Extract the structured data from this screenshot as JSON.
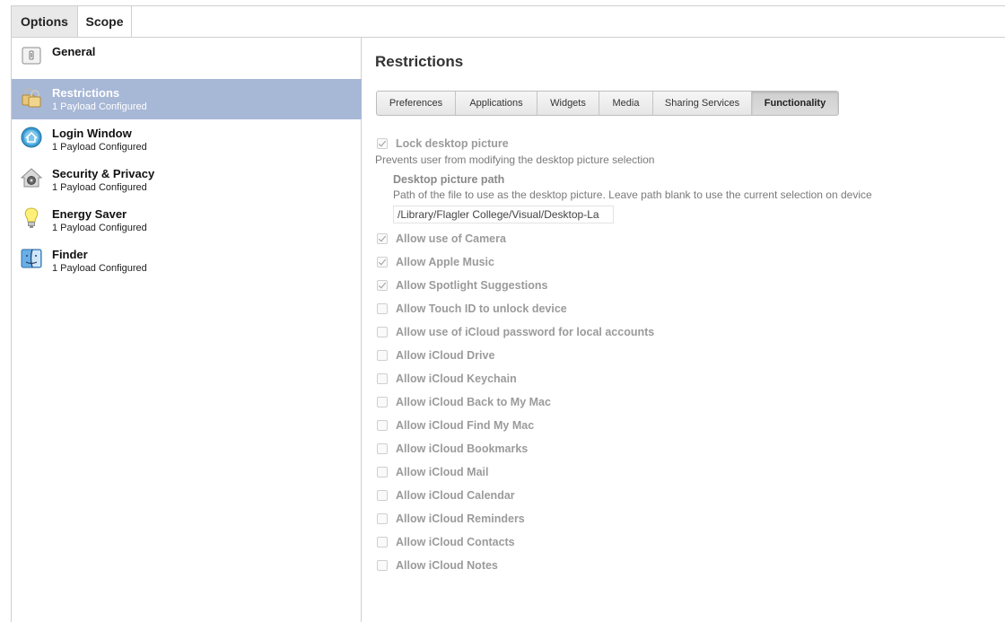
{
  "top_tabs": [
    {
      "label": "Options",
      "active": true
    },
    {
      "label": "Scope",
      "active": false
    }
  ],
  "sidebar": {
    "items": [
      {
        "title": "General",
        "subtitle": "",
        "icon": "general-icon",
        "selected": false
      },
      {
        "title": "Restrictions",
        "subtitle": "1 Payload Configured",
        "icon": "lock-icon",
        "selected": true
      },
      {
        "title": "Login Window",
        "subtitle": "1 Payload Configured",
        "icon": "login-window-icon",
        "selected": false
      },
      {
        "title": "Security & Privacy",
        "subtitle": "1 Payload Configured",
        "icon": "security-privacy-icon",
        "selected": false
      },
      {
        "title": "Energy Saver",
        "subtitle": "1 Payload Configured",
        "icon": "lightbulb-icon",
        "selected": false
      },
      {
        "title": "Finder",
        "subtitle": "1 Payload Configured",
        "icon": "finder-icon",
        "selected": false
      }
    ],
    "selected_color": "#a7b7d6"
  },
  "main": {
    "title": "Restrictions",
    "tabs": [
      {
        "label": "Preferences",
        "active": false
      },
      {
        "label": "Applications",
        "active": false
      },
      {
        "label": "Widgets",
        "active": false
      },
      {
        "label": "Media",
        "active": false
      },
      {
        "label": "Sharing Services",
        "active": false
      },
      {
        "label": "Functionality",
        "active": true
      }
    ],
    "lock_desktop": {
      "label": "Lock desktop picture",
      "checked": true,
      "description": "Prevents user from modifying the desktop picture selection"
    },
    "desktop_path": {
      "title": "Desktop picture path",
      "description": "Path of the file to use as the desktop picture. Leave path blank to use the current selection on device",
      "value": "/Library/Flagler College/Visual/Desktop-La"
    },
    "options": [
      {
        "label": "Allow use of Camera",
        "checked": true
      },
      {
        "label": "Allow Apple Music",
        "checked": true
      },
      {
        "label": "Allow Spotlight Suggestions",
        "checked": true
      },
      {
        "label": "Allow Touch ID to unlock device",
        "checked": false
      },
      {
        "label": "Allow use of iCloud password for local accounts",
        "checked": false
      },
      {
        "label": "Allow iCloud Drive",
        "checked": false
      },
      {
        "label": "Allow iCloud Keychain",
        "checked": false
      },
      {
        "label": "Allow iCloud Back to My Mac",
        "checked": false
      },
      {
        "label": "Allow iCloud Find My Mac",
        "checked": false
      },
      {
        "label": "Allow iCloud Bookmarks",
        "checked": false
      },
      {
        "label": "Allow iCloud Mail",
        "checked": false
      },
      {
        "label": "Allow iCloud Calendar",
        "checked": false
      },
      {
        "label": "Allow iCloud Reminders",
        "checked": false
      },
      {
        "label": "Allow iCloud Contacts",
        "checked": false
      },
      {
        "label": "Allow iCloud Notes",
        "checked": false
      }
    ]
  }
}
